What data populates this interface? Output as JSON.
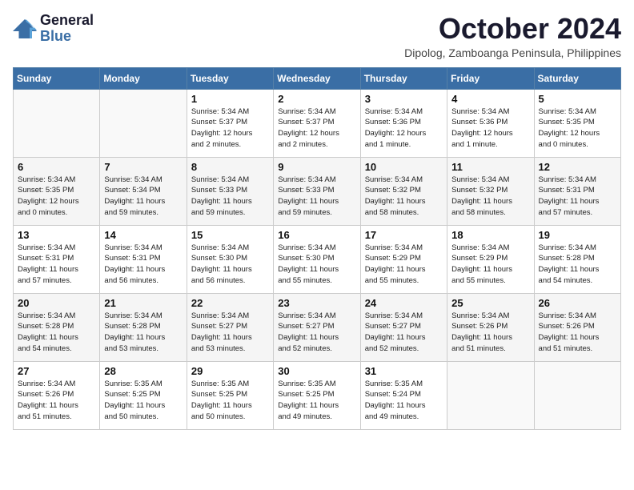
{
  "header": {
    "logo_line1": "General",
    "logo_line2": "Blue",
    "month_title": "October 2024",
    "subtitle": "Dipolog, Zamboanga Peninsula, Philippines"
  },
  "weekdays": [
    "Sunday",
    "Monday",
    "Tuesday",
    "Wednesday",
    "Thursday",
    "Friday",
    "Saturday"
  ],
  "weeks": [
    [
      {
        "day": "",
        "info": ""
      },
      {
        "day": "",
        "info": ""
      },
      {
        "day": "1",
        "info": "Sunrise: 5:34 AM\nSunset: 5:37 PM\nDaylight: 12 hours\nand 2 minutes."
      },
      {
        "day": "2",
        "info": "Sunrise: 5:34 AM\nSunset: 5:37 PM\nDaylight: 12 hours\nand 2 minutes."
      },
      {
        "day": "3",
        "info": "Sunrise: 5:34 AM\nSunset: 5:36 PM\nDaylight: 12 hours\nand 1 minute."
      },
      {
        "day": "4",
        "info": "Sunrise: 5:34 AM\nSunset: 5:36 PM\nDaylight: 12 hours\nand 1 minute."
      },
      {
        "day": "5",
        "info": "Sunrise: 5:34 AM\nSunset: 5:35 PM\nDaylight: 12 hours\nand 0 minutes."
      }
    ],
    [
      {
        "day": "6",
        "info": "Sunrise: 5:34 AM\nSunset: 5:35 PM\nDaylight: 12 hours\nand 0 minutes."
      },
      {
        "day": "7",
        "info": "Sunrise: 5:34 AM\nSunset: 5:34 PM\nDaylight: 11 hours\nand 59 minutes."
      },
      {
        "day": "8",
        "info": "Sunrise: 5:34 AM\nSunset: 5:33 PM\nDaylight: 11 hours\nand 59 minutes."
      },
      {
        "day": "9",
        "info": "Sunrise: 5:34 AM\nSunset: 5:33 PM\nDaylight: 11 hours\nand 59 minutes."
      },
      {
        "day": "10",
        "info": "Sunrise: 5:34 AM\nSunset: 5:32 PM\nDaylight: 11 hours\nand 58 minutes."
      },
      {
        "day": "11",
        "info": "Sunrise: 5:34 AM\nSunset: 5:32 PM\nDaylight: 11 hours\nand 58 minutes."
      },
      {
        "day": "12",
        "info": "Sunrise: 5:34 AM\nSunset: 5:31 PM\nDaylight: 11 hours\nand 57 minutes."
      }
    ],
    [
      {
        "day": "13",
        "info": "Sunrise: 5:34 AM\nSunset: 5:31 PM\nDaylight: 11 hours\nand 57 minutes."
      },
      {
        "day": "14",
        "info": "Sunrise: 5:34 AM\nSunset: 5:31 PM\nDaylight: 11 hours\nand 56 minutes."
      },
      {
        "day": "15",
        "info": "Sunrise: 5:34 AM\nSunset: 5:30 PM\nDaylight: 11 hours\nand 56 minutes."
      },
      {
        "day": "16",
        "info": "Sunrise: 5:34 AM\nSunset: 5:30 PM\nDaylight: 11 hours\nand 55 minutes."
      },
      {
        "day": "17",
        "info": "Sunrise: 5:34 AM\nSunset: 5:29 PM\nDaylight: 11 hours\nand 55 minutes."
      },
      {
        "day": "18",
        "info": "Sunrise: 5:34 AM\nSunset: 5:29 PM\nDaylight: 11 hours\nand 55 minutes."
      },
      {
        "day": "19",
        "info": "Sunrise: 5:34 AM\nSunset: 5:28 PM\nDaylight: 11 hours\nand 54 minutes."
      }
    ],
    [
      {
        "day": "20",
        "info": "Sunrise: 5:34 AM\nSunset: 5:28 PM\nDaylight: 11 hours\nand 54 minutes."
      },
      {
        "day": "21",
        "info": "Sunrise: 5:34 AM\nSunset: 5:28 PM\nDaylight: 11 hours\nand 53 minutes."
      },
      {
        "day": "22",
        "info": "Sunrise: 5:34 AM\nSunset: 5:27 PM\nDaylight: 11 hours\nand 53 minutes."
      },
      {
        "day": "23",
        "info": "Sunrise: 5:34 AM\nSunset: 5:27 PM\nDaylight: 11 hours\nand 52 minutes."
      },
      {
        "day": "24",
        "info": "Sunrise: 5:34 AM\nSunset: 5:27 PM\nDaylight: 11 hours\nand 52 minutes."
      },
      {
        "day": "25",
        "info": "Sunrise: 5:34 AM\nSunset: 5:26 PM\nDaylight: 11 hours\nand 51 minutes."
      },
      {
        "day": "26",
        "info": "Sunrise: 5:34 AM\nSunset: 5:26 PM\nDaylight: 11 hours\nand 51 minutes."
      }
    ],
    [
      {
        "day": "27",
        "info": "Sunrise: 5:34 AM\nSunset: 5:26 PM\nDaylight: 11 hours\nand 51 minutes."
      },
      {
        "day": "28",
        "info": "Sunrise: 5:35 AM\nSunset: 5:25 PM\nDaylight: 11 hours\nand 50 minutes."
      },
      {
        "day": "29",
        "info": "Sunrise: 5:35 AM\nSunset: 5:25 PM\nDaylight: 11 hours\nand 50 minutes."
      },
      {
        "day": "30",
        "info": "Sunrise: 5:35 AM\nSunset: 5:25 PM\nDaylight: 11 hours\nand 49 minutes."
      },
      {
        "day": "31",
        "info": "Sunrise: 5:35 AM\nSunset: 5:24 PM\nDaylight: 11 hours\nand 49 minutes."
      },
      {
        "day": "",
        "info": ""
      },
      {
        "day": "",
        "info": ""
      }
    ]
  ]
}
